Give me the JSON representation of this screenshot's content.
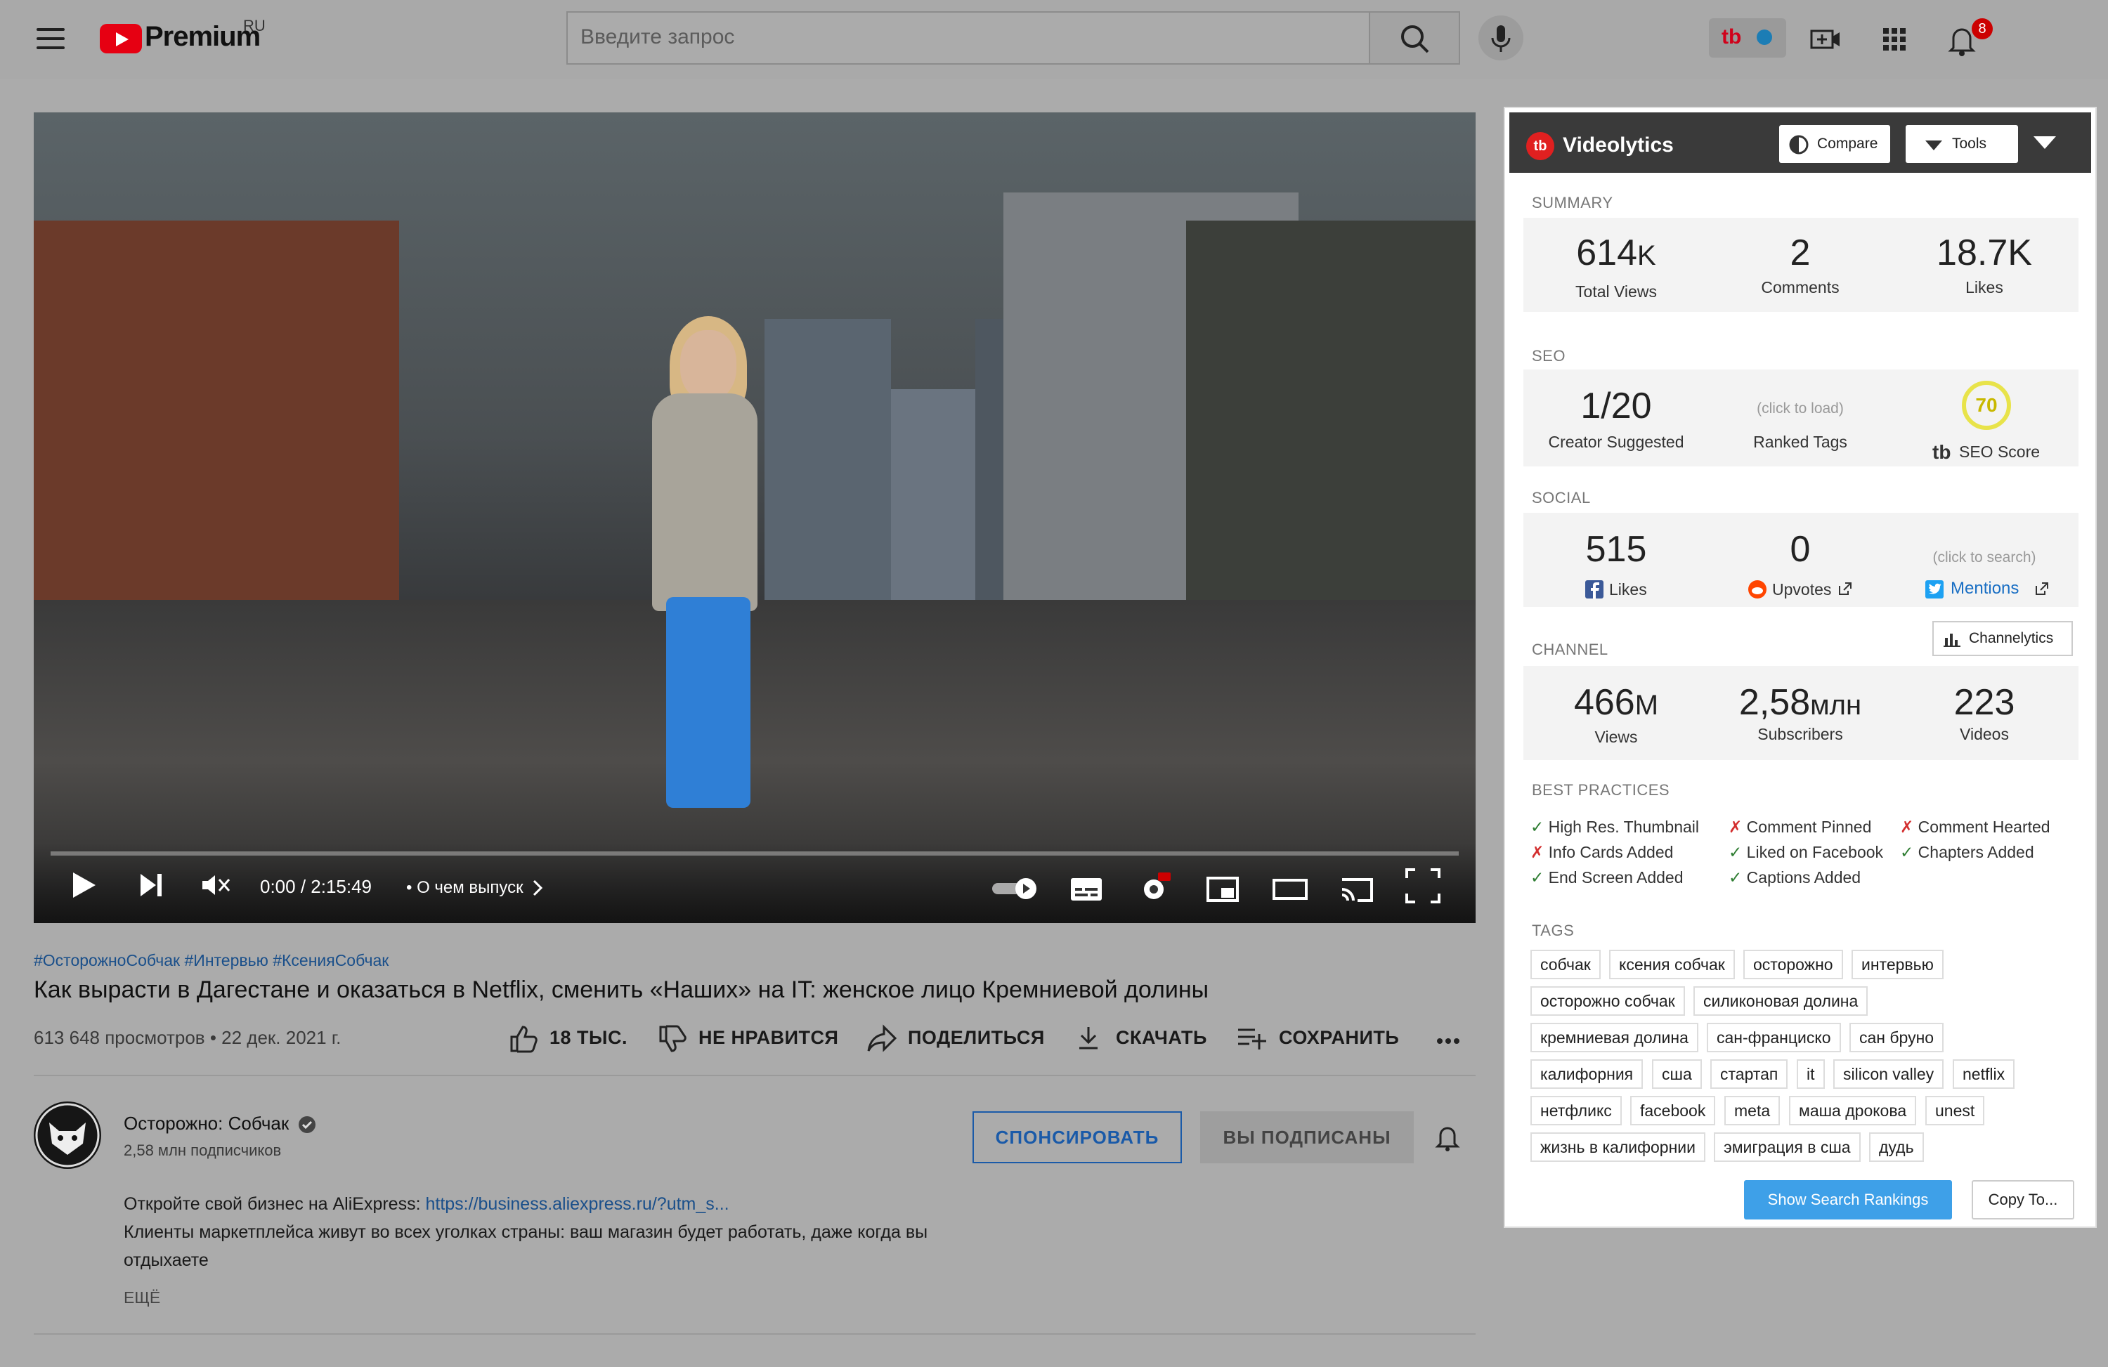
{
  "topbar": {
    "brand": "Premium",
    "brand_region": "RU",
    "search_placeholder": "Введите запрос",
    "notification_count": "8"
  },
  "player": {
    "time": "0:00 / 2:15:49",
    "chapter": "• О чем выпуск",
    "progress_fraction": 0.0
  },
  "video": {
    "hashtags": "#ОсторожноСобчак #Интервью #КсенияСобчак",
    "title": "Как вырасти в Дагестане и оказаться в Netflix, сменить «Наших» на IT: женское лицо Кремниевой долины",
    "views_date": "613 648 просмотров • 22 дек. 2021 г.",
    "actions": {
      "like": "18 ТЫС.",
      "dislike": "НЕ НРАВИТСЯ",
      "share": "ПОДЕЛИТЬСЯ",
      "download": "СКАЧАТЬ",
      "save": "СОХРАНИТЬ"
    }
  },
  "channel": {
    "name": "Осторожно: Собчак",
    "subscribers": "2,58 млн подписчиков",
    "sponsor": "СПОНСИРОВАТЬ",
    "subscribed": "ВЫ ПОДПИСАНЫ"
  },
  "description": {
    "line1_prefix": "Откройте свой бизнес на AliExpress: ",
    "line1_link": "https://business.aliexpress.ru/?utm_s...",
    "line2": "Клиенты маркетплейса живут во всех уголках страны: ваш магазин будет работать, даже когда вы",
    "line3": "отдыхаете",
    "more": "ЕЩЁ"
  },
  "videolytics": {
    "title": "Videolytics",
    "compare": "Compare",
    "tools": "Tools",
    "summary": {
      "label": "SUMMARY",
      "views": "614",
      "views_unit": "K",
      "views_label": "Total Views",
      "comments": "2",
      "comments_label": "Comments",
      "likes": "18.7K",
      "likes_label": "Likes"
    },
    "seo": {
      "label": "SEO",
      "creator": "1/20",
      "creator_label": "Creator Suggested",
      "ranked_hint": "(click to load)",
      "ranked_label": "Ranked Tags",
      "score": "70",
      "score_label": "SEO Score",
      "score_logo": "tb"
    },
    "social": {
      "label": "SOCIAL",
      "fb": "515",
      "fb_label": "Likes",
      "reddit": "0",
      "reddit_label": "Upvotes",
      "tw_hint": "(click to search)",
      "tw_label": "Mentions"
    },
    "channel": {
      "label": "CHANNEL",
      "channelytics": "Channelytics",
      "views": "466",
      "views_unit": "M",
      "views_label": "Views",
      "subs": "2,58",
      "subs_unit": "млн",
      "subs_label": "Subscribers",
      "videos": "223",
      "videos_label": "Videos"
    },
    "best_practices": {
      "label": "BEST PRACTICES",
      "items": [
        {
          "mark": "✓",
          "text": "High Res. Thumbnail",
          "ok": true
        },
        {
          "mark": "✗",
          "text": "Comment Pinned",
          "ok": false
        },
        {
          "mark": "✗",
          "text": "Comment Hearted",
          "ok": false
        },
        {
          "mark": "✗",
          "text": "Info Cards Added",
          "ok": false
        },
        {
          "mark": "✓",
          "text": "Liked on Facebook",
          "ok": true
        },
        {
          "mark": "✓",
          "text": "Chapters Added",
          "ok": true
        },
        {
          "mark": "✓",
          "text": "End Screen Added",
          "ok": true
        },
        {
          "mark": "✓",
          "text": "Captions Added",
          "ok": true
        }
      ]
    },
    "tags": {
      "label": "TAGS",
      "rows": [
        [
          "собчак",
          "ксения собчак",
          "осторожно",
          "интервью"
        ],
        [
          "осторожно собчак",
          "силиконовая долина"
        ],
        [
          "кремниевая долина",
          "сан-франциско",
          "сан бруно"
        ],
        [
          "калифорния",
          "сша",
          "стартап",
          "it",
          "silicon valley",
          "netflix"
        ],
        [
          "нетфликс",
          "facebook",
          "meta",
          "маша дрокова",
          "unest"
        ],
        [
          "жизнь в калифорнии",
          "эмиграция в сша",
          "дудь"
        ]
      ]
    },
    "show_rankings": "Show Search Rankings",
    "copy_to": "Copy To..."
  }
}
